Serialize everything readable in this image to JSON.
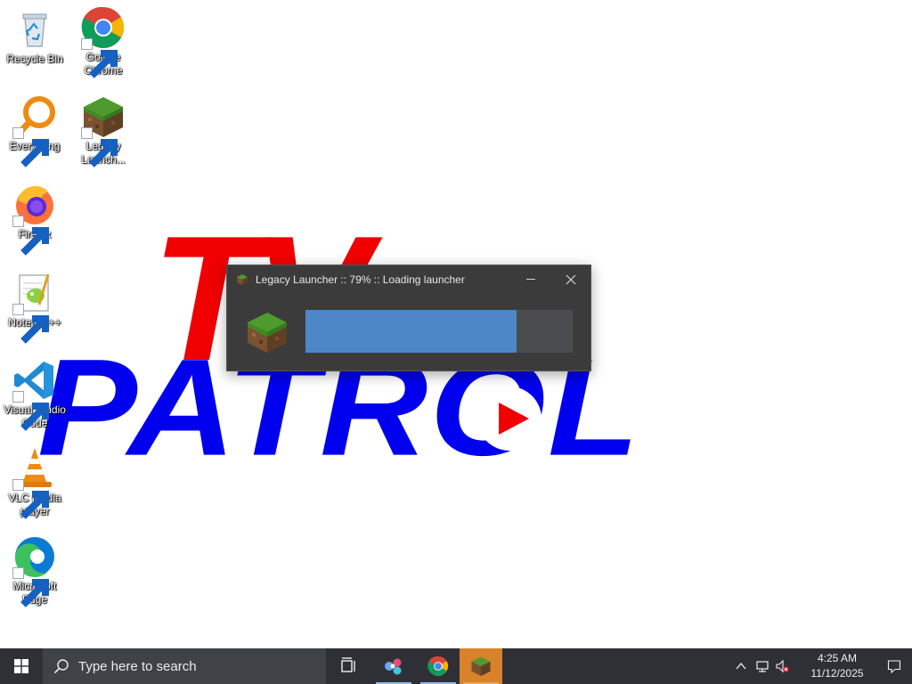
{
  "desktop": {
    "wallpaper": {
      "line1": "TV",
      "line2": "PATROL"
    },
    "icons": [
      {
        "label": "Recycle Bin",
        "icon": "recycle-bin-icon"
      },
      {
        "label": "Google Chrome",
        "icon": "chrome-icon"
      },
      {
        "label": "Everything",
        "icon": "everything-search-icon"
      },
      {
        "label": "Legacy Launch...",
        "icon": "minecraft-grass-block-icon"
      },
      {
        "label": "Firefox",
        "icon": "firefox-icon"
      },
      {
        "label": "Notepad++",
        "icon": "notepad-plus-plus-icon"
      },
      {
        "label": "Visual Studio Code",
        "icon": "vscode-icon"
      },
      {
        "label": "VLC media player",
        "icon": "vlc-cone-icon"
      },
      {
        "label": "Microsoft Edge",
        "icon": "edge-icon"
      }
    ]
  },
  "launcher": {
    "title": "Legacy Launcher :: 79% :: Loading launcher",
    "progress": 0.79,
    "colors": {
      "fill": "#4d87c7",
      "track": "#4b4c4f",
      "background": "#3b3b3b"
    }
  },
  "taskbar": {
    "search_placeholder": "Type here to search",
    "apps": [
      "task-view-icon",
      "people-hub-icon",
      "chrome-icon",
      "legacy-launcher-icon"
    ],
    "clock": {
      "time": "4:25 AM",
      "date": "11/12/2025"
    },
    "tray_icons": [
      "chevron-up-icon",
      "network-icon",
      "volume-muted-icon",
      "notification-icon"
    ]
  }
}
